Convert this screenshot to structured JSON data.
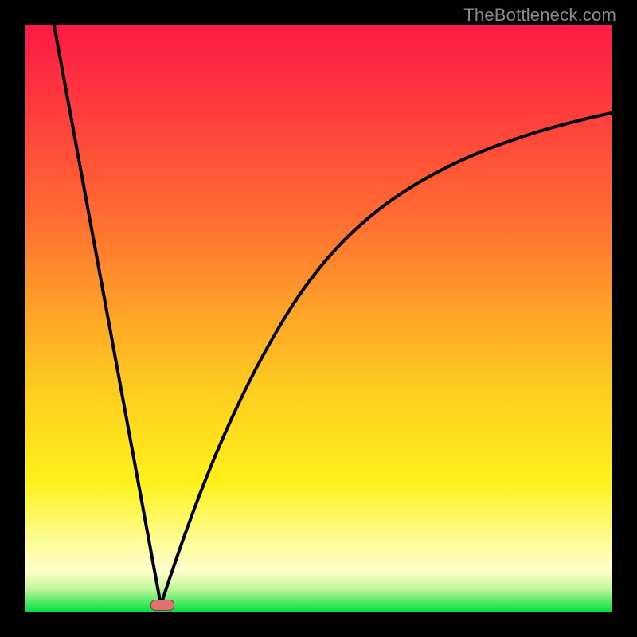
{
  "watermark": "TheBottleneck.com",
  "colors": {
    "frame": "#000000",
    "gradient_top": "#ff1a44",
    "gradient_mid": "#ffd21f",
    "gradient_bottom": "#00e040",
    "marker_fill": "#e07070",
    "marker_border": "#8a3a3a",
    "curve": "#000000"
  },
  "chart_data": {
    "type": "line",
    "title": "",
    "xlabel": "",
    "ylabel": "",
    "xlim": [
      0,
      100
    ],
    "ylim": [
      0,
      100
    ],
    "grid": false,
    "legend": false,
    "description": "V-shaped bottleneck curve: steep linear drop from top-left to a minimum near x≈23, then a concave rise toward the upper-right asymptote around y≈85.",
    "minimum": {
      "x": 23,
      "y": 0
    },
    "marker": {
      "x": 23,
      "y": 1,
      "shape": "pill"
    },
    "series": [
      {
        "name": "bottleneck",
        "x": [
          5,
          10,
          15,
          20,
          23,
          25,
          28,
          32,
          36,
          40,
          45,
          50,
          55,
          60,
          65,
          70,
          75,
          80,
          85,
          90,
          95,
          100
        ],
        "y": [
          100,
          72,
          44,
          16,
          0,
          8,
          19,
          32,
          42,
          50,
          57,
          63,
          68,
          71,
          74,
          77,
          79,
          80,
          82,
          83,
          84,
          85
        ]
      }
    ]
  }
}
